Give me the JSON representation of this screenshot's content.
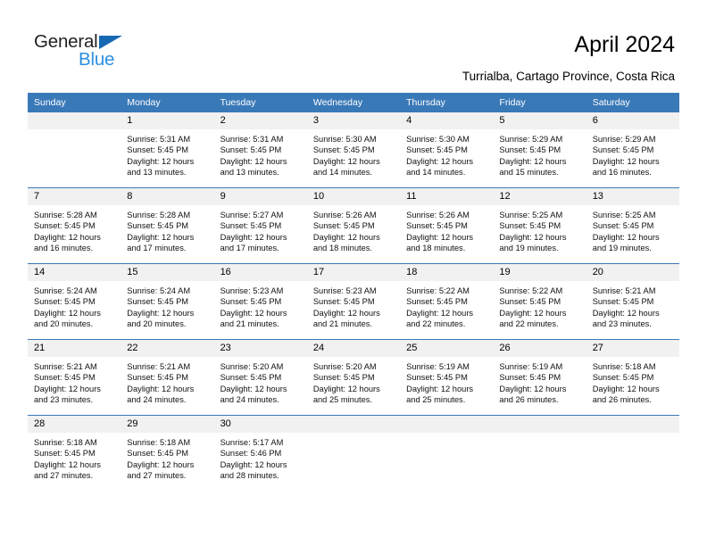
{
  "brand": {
    "word_one": "General",
    "word_two": "Blue",
    "logo_icon": "triangle-flag-icon",
    "accent_color": "#1668b3",
    "secondary_color": "#2b8fe0"
  },
  "header": {
    "title": "April 2024",
    "location": "Turrialba, Cartago Province, Costa Rica"
  },
  "calendar": {
    "header_bg": "#3a79b8",
    "header_text_color": "#ffffff",
    "daynum_bg": "#f1f1f1",
    "weekdays": [
      "Sunday",
      "Monday",
      "Tuesday",
      "Wednesday",
      "Thursday",
      "Friday",
      "Saturday"
    ],
    "weeks": [
      [
        {
          "day": "",
          "lines": []
        },
        {
          "day": "1",
          "lines": [
            "Sunrise: 5:31 AM",
            "Sunset: 5:45 PM",
            "Daylight: 12 hours",
            "and 13 minutes."
          ]
        },
        {
          "day": "2",
          "lines": [
            "Sunrise: 5:31 AM",
            "Sunset: 5:45 PM",
            "Daylight: 12 hours",
            "and 13 minutes."
          ]
        },
        {
          "day": "3",
          "lines": [
            "Sunrise: 5:30 AM",
            "Sunset: 5:45 PM",
            "Daylight: 12 hours",
            "and 14 minutes."
          ]
        },
        {
          "day": "4",
          "lines": [
            "Sunrise: 5:30 AM",
            "Sunset: 5:45 PM",
            "Daylight: 12 hours",
            "and 14 minutes."
          ]
        },
        {
          "day": "5",
          "lines": [
            "Sunrise: 5:29 AM",
            "Sunset: 5:45 PM",
            "Daylight: 12 hours",
            "and 15 minutes."
          ]
        },
        {
          "day": "6",
          "lines": [
            "Sunrise: 5:29 AM",
            "Sunset: 5:45 PM",
            "Daylight: 12 hours",
            "and 16 minutes."
          ]
        }
      ],
      [
        {
          "day": "7",
          "lines": [
            "Sunrise: 5:28 AM",
            "Sunset: 5:45 PM",
            "Daylight: 12 hours",
            "and 16 minutes."
          ]
        },
        {
          "day": "8",
          "lines": [
            "Sunrise: 5:28 AM",
            "Sunset: 5:45 PM",
            "Daylight: 12 hours",
            "and 17 minutes."
          ]
        },
        {
          "day": "9",
          "lines": [
            "Sunrise: 5:27 AM",
            "Sunset: 5:45 PM",
            "Daylight: 12 hours",
            "and 17 minutes."
          ]
        },
        {
          "day": "10",
          "lines": [
            "Sunrise: 5:26 AM",
            "Sunset: 5:45 PM",
            "Daylight: 12 hours",
            "and 18 minutes."
          ]
        },
        {
          "day": "11",
          "lines": [
            "Sunrise: 5:26 AM",
            "Sunset: 5:45 PM",
            "Daylight: 12 hours",
            "and 18 minutes."
          ]
        },
        {
          "day": "12",
          "lines": [
            "Sunrise: 5:25 AM",
            "Sunset: 5:45 PM",
            "Daylight: 12 hours",
            "and 19 minutes."
          ]
        },
        {
          "day": "13",
          "lines": [
            "Sunrise: 5:25 AM",
            "Sunset: 5:45 PM",
            "Daylight: 12 hours",
            "and 19 minutes."
          ]
        }
      ],
      [
        {
          "day": "14",
          "lines": [
            "Sunrise: 5:24 AM",
            "Sunset: 5:45 PM",
            "Daylight: 12 hours",
            "and 20 minutes."
          ]
        },
        {
          "day": "15",
          "lines": [
            "Sunrise: 5:24 AM",
            "Sunset: 5:45 PM",
            "Daylight: 12 hours",
            "and 20 minutes."
          ]
        },
        {
          "day": "16",
          "lines": [
            "Sunrise: 5:23 AM",
            "Sunset: 5:45 PM",
            "Daylight: 12 hours",
            "and 21 minutes."
          ]
        },
        {
          "day": "17",
          "lines": [
            "Sunrise: 5:23 AM",
            "Sunset: 5:45 PM",
            "Daylight: 12 hours",
            "and 21 minutes."
          ]
        },
        {
          "day": "18",
          "lines": [
            "Sunrise: 5:22 AM",
            "Sunset: 5:45 PM",
            "Daylight: 12 hours",
            "and 22 minutes."
          ]
        },
        {
          "day": "19",
          "lines": [
            "Sunrise: 5:22 AM",
            "Sunset: 5:45 PM",
            "Daylight: 12 hours",
            "and 22 minutes."
          ]
        },
        {
          "day": "20",
          "lines": [
            "Sunrise: 5:21 AM",
            "Sunset: 5:45 PM",
            "Daylight: 12 hours",
            "and 23 minutes."
          ]
        }
      ],
      [
        {
          "day": "21",
          "lines": [
            "Sunrise: 5:21 AM",
            "Sunset: 5:45 PM",
            "Daylight: 12 hours",
            "and 23 minutes."
          ]
        },
        {
          "day": "22",
          "lines": [
            "Sunrise: 5:21 AM",
            "Sunset: 5:45 PM",
            "Daylight: 12 hours",
            "and 24 minutes."
          ]
        },
        {
          "day": "23",
          "lines": [
            "Sunrise: 5:20 AM",
            "Sunset: 5:45 PM",
            "Daylight: 12 hours",
            "and 24 minutes."
          ]
        },
        {
          "day": "24",
          "lines": [
            "Sunrise: 5:20 AM",
            "Sunset: 5:45 PM",
            "Daylight: 12 hours",
            "and 25 minutes."
          ]
        },
        {
          "day": "25",
          "lines": [
            "Sunrise: 5:19 AM",
            "Sunset: 5:45 PM",
            "Daylight: 12 hours",
            "and 25 minutes."
          ]
        },
        {
          "day": "26",
          "lines": [
            "Sunrise: 5:19 AM",
            "Sunset: 5:45 PM",
            "Daylight: 12 hours",
            "and 26 minutes."
          ]
        },
        {
          "day": "27",
          "lines": [
            "Sunrise: 5:18 AM",
            "Sunset: 5:45 PM",
            "Daylight: 12 hours",
            "and 26 minutes."
          ]
        }
      ],
      [
        {
          "day": "28",
          "lines": [
            "Sunrise: 5:18 AM",
            "Sunset: 5:45 PM",
            "Daylight: 12 hours",
            "and 27 minutes."
          ]
        },
        {
          "day": "29",
          "lines": [
            "Sunrise: 5:18 AM",
            "Sunset: 5:45 PM",
            "Daylight: 12 hours",
            "and 27 minutes."
          ]
        },
        {
          "day": "30",
          "lines": [
            "Sunrise: 5:17 AM",
            "Sunset: 5:46 PM",
            "Daylight: 12 hours",
            "and 28 minutes."
          ]
        },
        {
          "day": "",
          "lines": []
        },
        {
          "day": "",
          "lines": []
        },
        {
          "day": "",
          "lines": []
        },
        {
          "day": "",
          "lines": []
        }
      ]
    ]
  }
}
